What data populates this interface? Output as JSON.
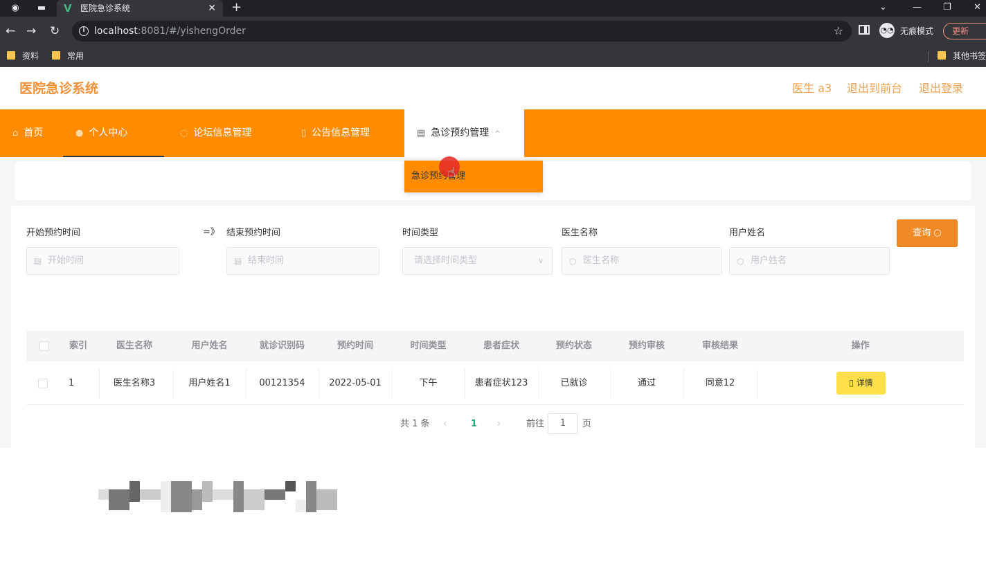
{
  "browser": {
    "tab_title": "医院急诊系统",
    "tab_close": "✕",
    "new_tab": "+",
    "url_host": "localhost",
    "url_rest": ":8081/#/yishengOrder",
    "incognito_label": "无痕模式",
    "update_label": "更新",
    "bookmarks": [
      "资料",
      "常用",
      "其他书签"
    ]
  },
  "header": {
    "title": "医院急诊系统",
    "user": "医生 a3",
    "to_front": "退出到前台",
    "logout": "退出登录"
  },
  "menu": {
    "items": [
      "首页",
      "个人中心",
      "论坛信息管理",
      "公告信息管理",
      "急诊预约管理"
    ],
    "dropdown_item": "急诊预约管理"
  },
  "search": {
    "start_label": "开始预约时间",
    "start_placeholder": "开始时间",
    "range_sep": "=》",
    "end_label": "结束预约时间",
    "end_placeholder": "结束时间",
    "type_label": "时间类型",
    "type_placeholder": "请选择时间类型",
    "doctor_label": "医生名称",
    "doctor_placeholder": "医生名称",
    "user_label": "用户姓名",
    "user_placeholder": "用户姓名",
    "query_label": "查询"
  },
  "table": {
    "columns": [
      "索引",
      "医生名称",
      "用户姓名",
      "就诊识别码",
      "预约时间",
      "时间类型",
      "患者症状",
      "预约状态",
      "预约审核",
      "审核结果",
      "操作"
    ],
    "rows": [
      [
        "1",
        "医生名称3",
        "用户姓名1",
        "00121354",
        "2022-05-01",
        "下午",
        "患者症状123",
        "已就诊",
        "通过",
        "同意12"
      ]
    ],
    "detail_label": "详情"
  },
  "pagination": {
    "total": "共 1 条",
    "current": "1",
    "goto": "前往",
    "page_input": "1",
    "page_suffix": "页"
  }
}
